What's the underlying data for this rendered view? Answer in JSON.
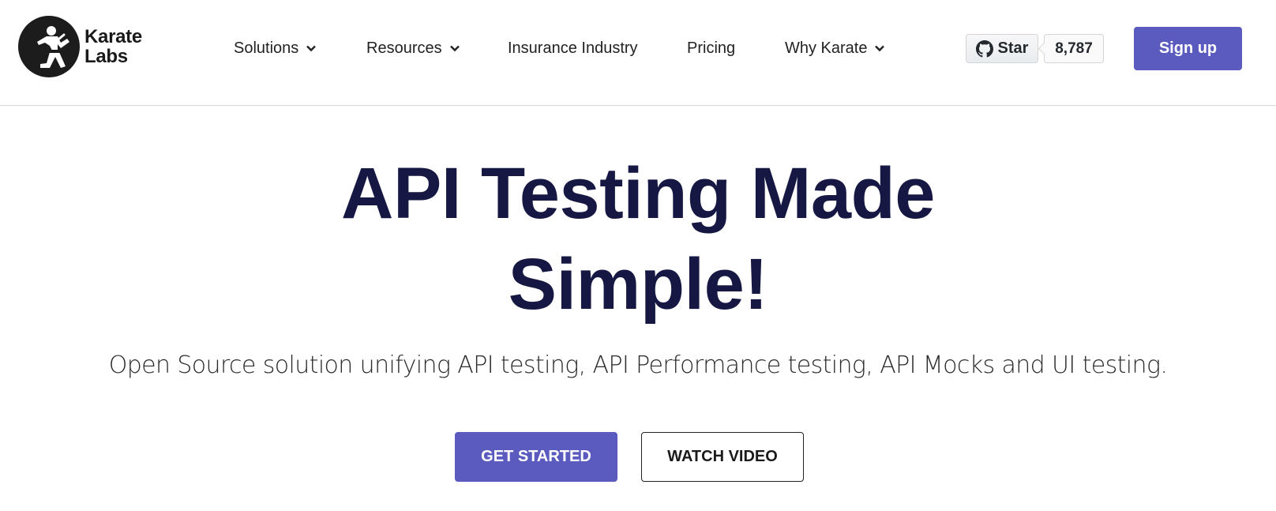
{
  "brand": {
    "line1": "Karate",
    "line2": "Labs",
    "icon": "karate-fighter-logo"
  },
  "nav": {
    "solutions": "Solutions",
    "resources": "Resources",
    "insurance": "Insurance Industry",
    "pricing": "Pricing",
    "why": "Why Karate"
  },
  "github": {
    "star_label": "Star",
    "count": "8,787",
    "icon": "github-icon"
  },
  "signup_label": "Sign up",
  "hero": {
    "title_line1": "API Testing Made",
    "title_line2": "Simple!",
    "subtitle": "Open Source solution unifying API testing, API Performance testing, API Mocks and UI testing."
  },
  "cta": {
    "get_started": "GET STARTED",
    "watch_video": "WATCH VIDEO"
  },
  "colors": {
    "accent": "#5b5bbf",
    "title": "#161843",
    "divider": "#d6d6d6"
  }
}
